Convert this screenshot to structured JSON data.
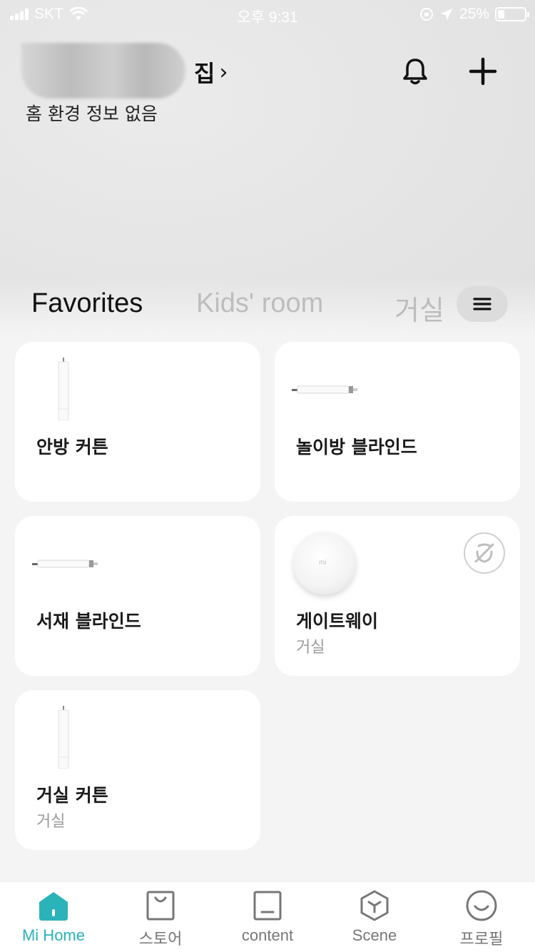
{
  "status_bar": {
    "carrier": "SKT",
    "time": "오후 9:31",
    "battery": "25%",
    "battery_level": 0.25
  },
  "header": {
    "home_name": "집",
    "chevron": "›",
    "subtitle": "홈 환경 정보 없음"
  },
  "tabs": [
    {
      "label": "Favorites",
      "active": true
    },
    {
      "label": "Kids' room",
      "active": false
    },
    {
      "label": "거실",
      "active": false
    }
  ],
  "devices": [
    {
      "name": "안방 커튼",
      "room": "",
      "icon": "curtain-motor-icon"
    },
    {
      "name": "놀이방 블라인드",
      "room": "",
      "icon": "blind-motor-icon"
    },
    {
      "name": "서재 블라인드",
      "room": "",
      "icon": "blind-motor-icon"
    },
    {
      "name": "게이트웨이",
      "room": "거실",
      "icon": "gateway-icon",
      "offline": true,
      "logo": "mi"
    },
    {
      "name": "거실 커튼",
      "room": "거실",
      "icon": "curtain-motor-icon"
    }
  ],
  "bottom_nav": [
    {
      "label": "Mi Home",
      "icon": "home-icon",
      "active": true
    },
    {
      "label": "스토어",
      "icon": "store-bag-icon",
      "active": false
    },
    {
      "label": "content",
      "icon": "content-icon",
      "active": false
    },
    {
      "label": "Scene",
      "icon": "scene-cube-icon",
      "active": false
    },
    {
      "label": "프로필",
      "icon": "profile-smile-icon",
      "active": false
    }
  ],
  "colors": {
    "accent": "#2ab3b9",
    "background": "#f4f4f4",
    "card": "#ffffff",
    "inactive_tab": "#bdbdbd"
  }
}
